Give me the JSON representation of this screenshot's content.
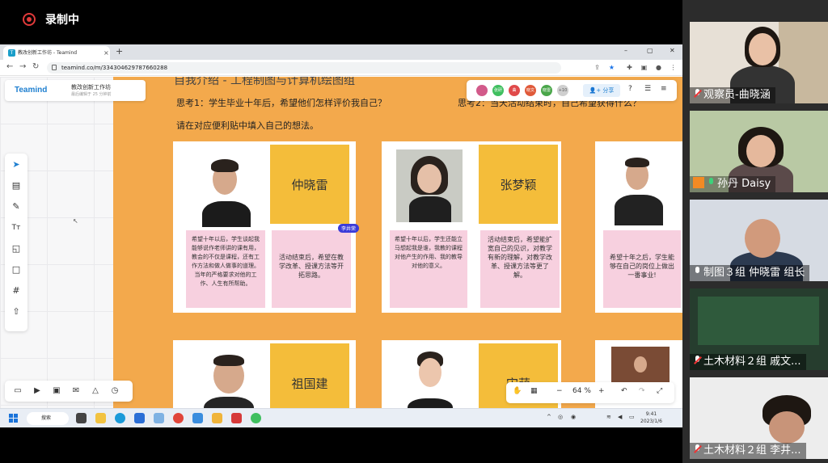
{
  "recording": {
    "label": "录制中"
  },
  "browser": {
    "tab_title": "教改创新工作坊 - Teamind",
    "new_tab": "+",
    "url": "teamind.co/m/334304629787660288",
    "win_min": "–",
    "win_max": "▢",
    "win_close": "✕"
  },
  "teamind": {
    "brand": "Teamind",
    "board_title": "教改创新工作坊",
    "board_sub": "最后编辑于 25 分钟前",
    "share_label": "分享",
    "avatars": [
      {
        "label": "",
        "color": "#d25a8a"
      },
      {
        "label": "张研",
        "color": "#3fbf5f"
      },
      {
        "label": "曲",
        "color": "#e04a4a"
      },
      {
        "label": "晓文",
        "color": "#e05a3a"
      },
      {
        "label": "晓雷",
        "color": "#4aa64a"
      },
      {
        "label": "+10",
        "color": "#cfcfcf"
      }
    ],
    "zoom": "64 %",
    "zoom_minus": "−",
    "zoom_plus": "+"
  },
  "canvas": {
    "heading": "自我介绍 - 工程制图与计算机绘图组",
    "think1": "思考1：学生毕业十年后，希望他们怎样评价我自己？",
    "think2": "思考2：当天活动结束时，自己希望获得什么？",
    "instruction": "请在对应便利贴中填入自己的想法。",
    "cursor_tag": "李井荣",
    "cards": [
      {
        "name": "仲晓雷",
        "note1": "希望十年以后，学生谈起我能够说作老师讲的课有用，教会的不仅是课程，还有工作方法和做人做事的道理。当年的严格要求对他的工作、人生有所帮助。",
        "note2": "活动结束后，希望在教学改革、授课方法等开拓思路。"
      },
      {
        "name": "张梦颖",
        "note1": "希望十年以后，学生还能立马想起我是谁，我教的课程对他产生的作用、我的教导对他的意义。",
        "note2": "活动结束后，希望能扩宽自己的见识，对教学有新的理解，对教学改革、授课方法等更了解。"
      },
      {
        "name": "",
        "note1": "希望十年之后，学生能够在自己的岗位上做出一番事业!",
        "note2": ""
      },
      {
        "name": "祖国建",
        "note1": "",
        "note2": ""
      },
      {
        "name": "宋萌",
        "note1": "",
        "note2": ""
      }
    ]
  },
  "taskbar": {
    "search": "搜索",
    "time": "9:41",
    "date": "2023/1/6"
  },
  "participants": [
    {
      "name": "观察员-曲晓涵",
      "mic": "muted"
    },
    {
      "name": "孙丹 Daisy",
      "mic": "on"
    },
    {
      "name": "制图３组 仲晓雷 组长",
      "mic": "normal"
    },
    {
      "name": "土木材料２组 戚文...",
      "mic": "muted"
    },
    {
      "name": "土木材料２组 李井...",
      "mic": "muted"
    }
  ]
}
